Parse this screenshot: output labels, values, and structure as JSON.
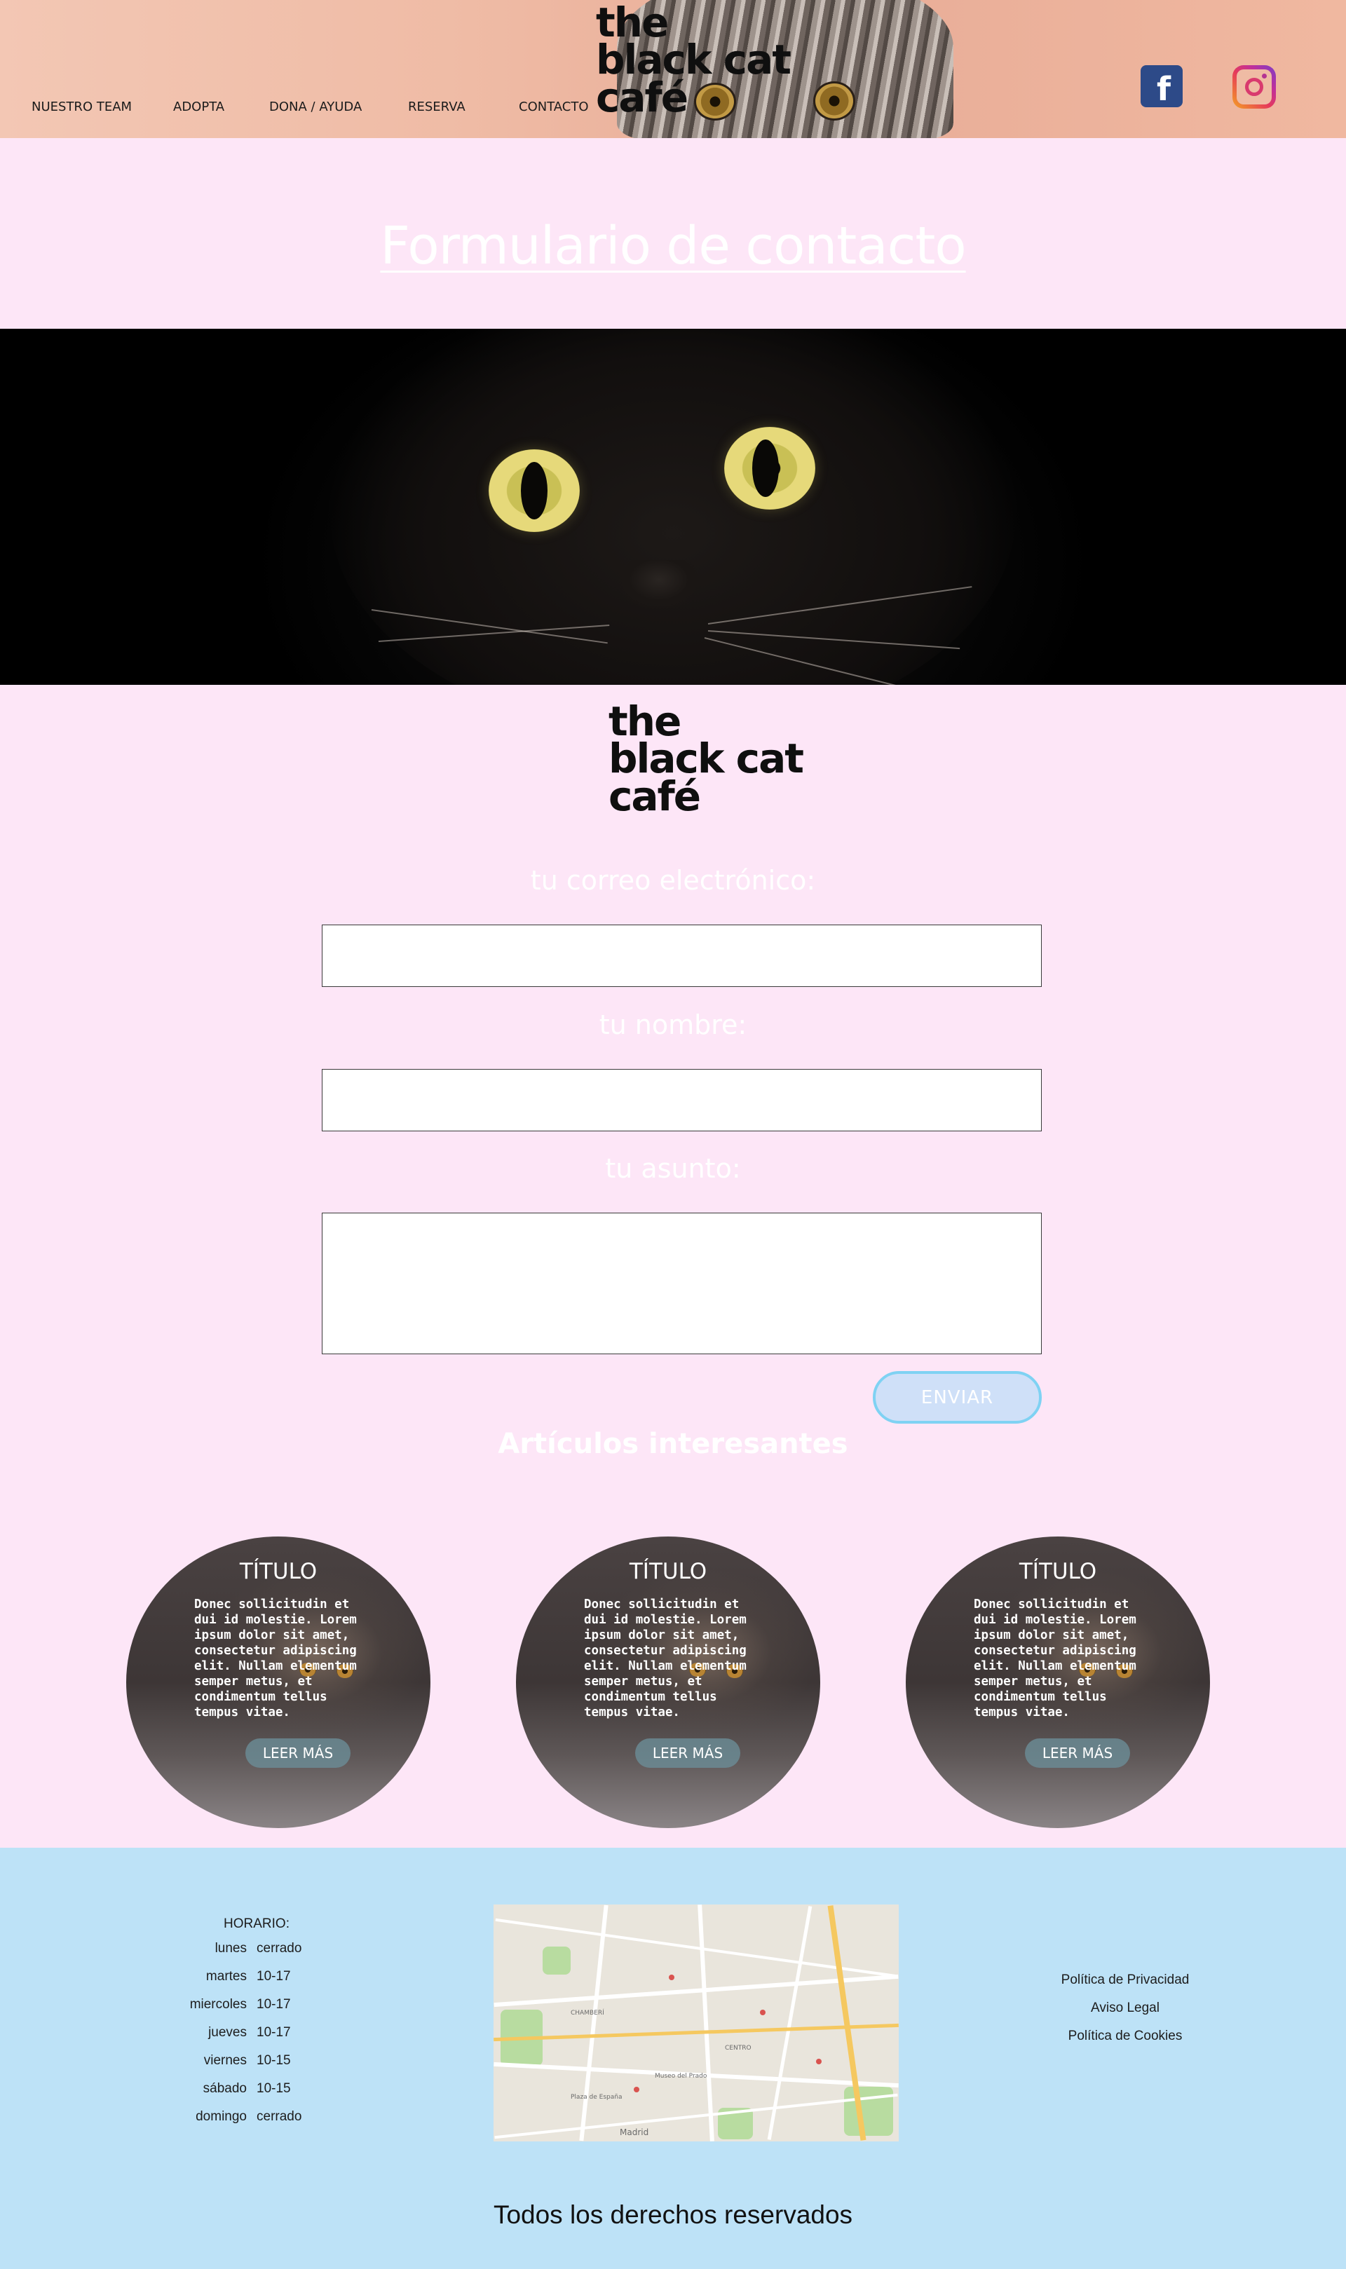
{
  "header": {
    "nav": [
      "NUESTRO TEAM",
      "ADOPTA",
      "DONA / AYUDA",
      "RESERVA",
      "CONTACTO"
    ],
    "logo_lines": [
      "the",
      "black cat",
      "café"
    ],
    "social": {
      "facebook_glyph": "f",
      "facebook_color": "#2d4a88"
    }
  },
  "contact": {
    "title": "Formulario de contacto",
    "logo_lines": [
      "the",
      "black cat",
      "café"
    ],
    "email_label": "tu correo electrónico:",
    "email_value": "",
    "name_label": "tu nombre:",
    "name_value": "",
    "subject_label": "tu asunto:",
    "subject_value": "",
    "send_label": "ENVIAR"
  },
  "articles": {
    "title": "Artículos interesantes",
    "items": [
      {
        "title": "TÍTULO",
        "body": "Donec sollicitudin et dui id molestie. Lorem ipsum dolor sit amet, consectetur adipiscing elit. Nullam elementum semper metus, et condimentum tellus tempus vitae.",
        "button": "LEER MÁS"
      },
      {
        "title": "TÍTULO",
        "body": "Donec sollicitudin et dui id molestie. Lorem ipsum dolor sit amet, consectetur adipiscing elit. Nullam elementum semper metus, et condimentum tellus tempus vitae.",
        "button": "LEER MÁS"
      },
      {
        "title": "TÍTULO",
        "body": "Donec sollicitudin et dui id molestie. Lorem ipsum dolor sit amet, consectetur adipiscing elit. Nullam elementum semper metus, et condimentum tellus tempus vitae.",
        "button": "LEER MÁS"
      }
    ]
  },
  "footer": {
    "hours_title": "HORARIO:",
    "hours": [
      {
        "day": "lunes",
        "time": "cerrado"
      },
      {
        "day": "martes",
        "time": "10-17"
      },
      {
        "day": "miercoles",
        "time": "10-17"
      },
      {
        "day": "jueves",
        "time": "10-17"
      },
      {
        "day": "viernes",
        "time": "10-15"
      },
      {
        "day": "sábado",
        "time": "10-15"
      },
      {
        "day": "domingo",
        "time": "cerrado"
      }
    ],
    "map_labels": [
      "CHAMBERÍ",
      "CENTRO",
      "Madrid",
      "Museo del Prado",
      "Plaza de España"
    ],
    "legal_links": [
      "Política de Privacidad",
      "Aviso Legal",
      "Política de Cookies"
    ],
    "rights": "Todos los derechos reservados"
  },
  "colors": {
    "page_bg": "#fde6f7",
    "footer_bg": "#bde2f7",
    "send_border": "#7fd2f3"
  }
}
